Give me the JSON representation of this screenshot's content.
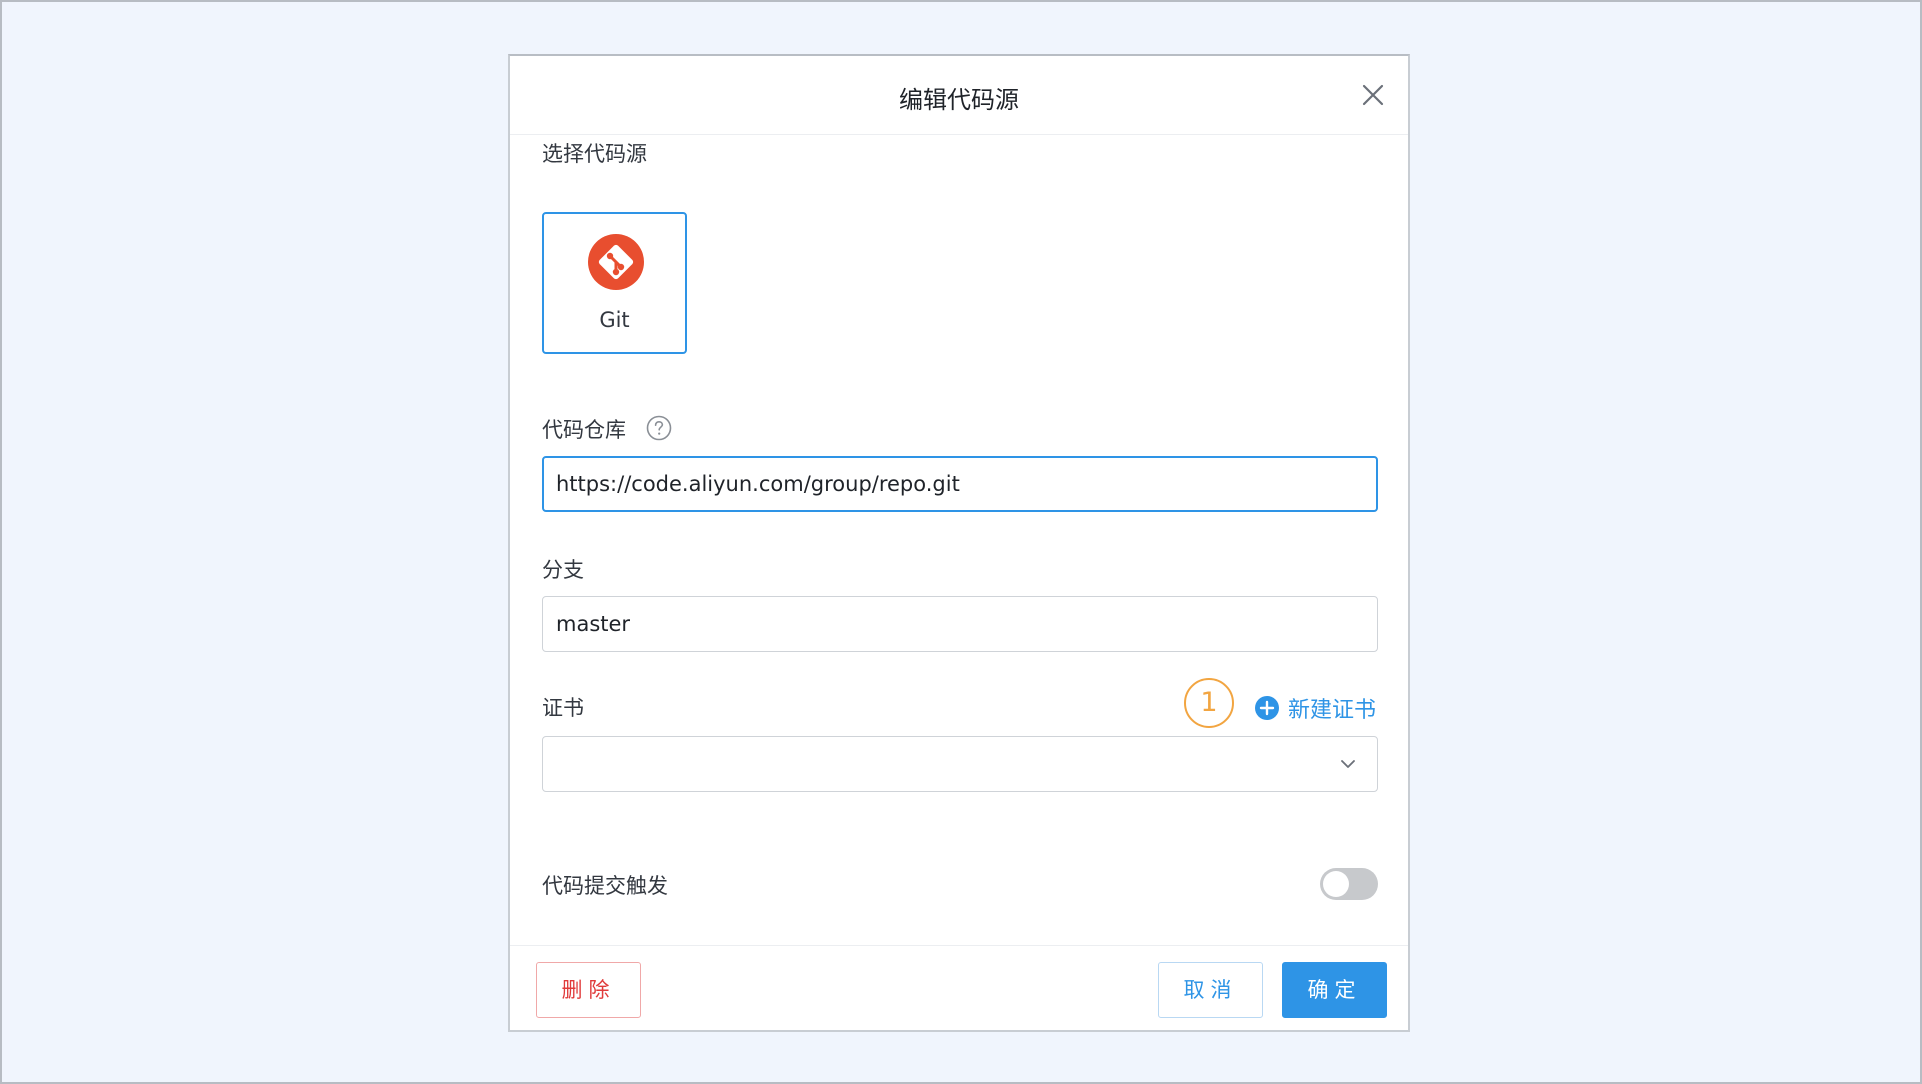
{
  "dialog": {
    "title": "编辑代码源",
    "close_icon": "close-icon"
  },
  "source_section": {
    "label": "选择代码源",
    "options": [
      {
        "label": "Git",
        "icon": "git-icon",
        "selected": true,
        "icon_color": "#e84e2f"
      }
    ]
  },
  "repo": {
    "label": "代码仓库",
    "help_icon": "question-circle-icon",
    "value": "https://code.aliyun.com/group/repo.git"
  },
  "branch": {
    "label": "分支",
    "value": "master"
  },
  "cert": {
    "label": "证书",
    "step_badge": "1",
    "new_cert_label": "新建证书",
    "new_cert_icon": "plus-circle-icon",
    "value": ""
  },
  "trigger": {
    "label": "代码提交触发",
    "enabled": false
  },
  "footer": {
    "delete_label": "删除",
    "cancel_label": "取消",
    "ok_label": "确定"
  },
  "colors": {
    "accent": "#2e94e6",
    "danger": "#e03a3a",
    "badge": "#f2a541",
    "background": "#f0f5fd"
  }
}
